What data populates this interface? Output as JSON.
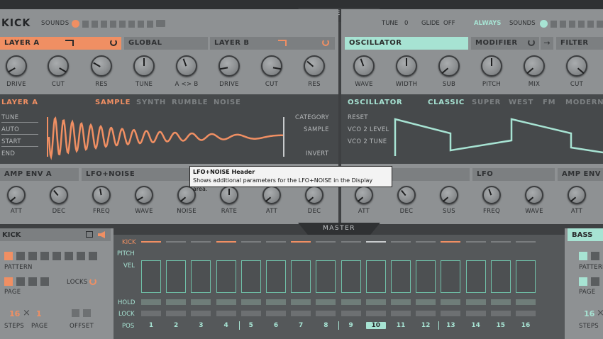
{
  "top_bar": {
    "effects_label": "EFFECTS",
    "master_label": "MASTER"
  },
  "left": {
    "title": "KICK",
    "sounds_label": "SOUNDS",
    "headers": {
      "layer_a": "LAYER A",
      "global": "GLOBAL",
      "layer_b": "LAYER B"
    },
    "knobs": [
      "DRIVE",
      "CUT",
      "RES",
      "TUNE",
      "A <> B",
      "DRIVE",
      "CUT",
      "RES"
    ],
    "display": {
      "title": "LAYER A",
      "tabs": [
        "SAMPLE",
        "SYNTH",
        "RUMBLE",
        "NOISE"
      ],
      "selected_tab": "SAMPLE",
      "left_params": [
        "TUNE",
        "AUTO",
        "START",
        "END"
      ],
      "right_params": [
        "CATEGORY",
        "SAMPLE",
        "INVERT"
      ]
    },
    "mod_headers": {
      "amp_env": "AMP ENV A",
      "lfo_noise": "LFO+NOISE"
    },
    "mod_knobs": [
      "ATT",
      "DEC",
      "FREQ",
      "WAVE",
      "NOISE",
      "RATE",
      "ATT",
      "DEC"
    ]
  },
  "right": {
    "tune_label": "TUNE",
    "tune_value": "0",
    "glide_label": "GLIDE",
    "glide_value": "OFF",
    "always_label": "ALWAYS",
    "sounds_label": "SOUNDS",
    "headers": {
      "oscillator": "OSCILLATOR",
      "modifier": "MODIFIER",
      "filter": "FILTER"
    },
    "knobs": [
      "WAVE",
      "WIDTH",
      "SUB",
      "PITCH",
      "MIX",
      "CUT"
    ],
    "display": {
      "title": "OSCILLATOR",
      "tabs": [
        "CLASSIC",
        "SUPER",
        "WEST",
        "FM",
        "MODERN"
      ],
      "selected_tab": "CLASSIC",
      "left_params": [
        "RESET",
        "VCO 2 LEVEL",
        "VCO 2 TUNE"
      ]
    },
    "mod_headers": {
      "lfo": "LFO",
      "amp_env": "AMP ENV"
    },
    "mod_knobs": [
      "ATT",
      "DEC",
      "SUS",
      "FREQ",
      "WAVE",
      "ATT"
    ]
  },
  "tooltip": {
    "title": "LFO+NOISE Header",
    "body": "Shows additional parameters for the LFO+NOISE in the Display area."
  },
  "bottom": {
    "left_title": "KICK",
    "pattern_label": "PATTERN",
    "page_label": "PAGE",
    "locks_label": "LOCKS",
    "steps_value": "16",
    "page_value": "1",
    "steps_label": "STEPS",
    "page_label2": "PAGE",
    "offset_label": "OFFSET",
    "row_labels": [
      "KICK",
      "PITCH",
      "VEL",
      "HOLD",
      "LOCK",
      "POS"
    ],
    "positions": [
      "1",
      "2",
      "3",
      "4",
      "5",
      "6",
      "7",
      "8",
      "9",
      "10",
      "11",
      "12",
      "13",
      "14",
      "15",
      "16"
    ],
    "selected_position": "10",
    "right_title": "BASS",
    "right_pattern_label": "PATTERN",
    "right_page_label": "PAGE",
    "right_steps_value": "16",
    "right_steps_label": "STEPS"
  },
  "colors": {
    "accent_orange": "#f08f63",
    "accent_green": "#a7e3d3",
    "panel": "#8e9193",
    "display": "#46494b"
  }
}
